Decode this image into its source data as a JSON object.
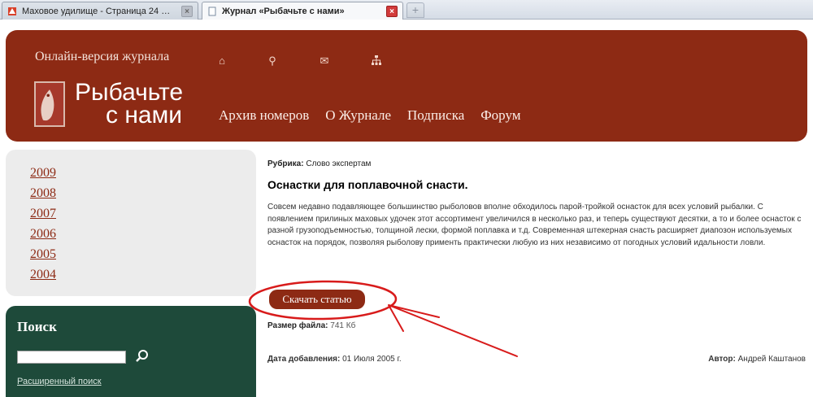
{
  "browser": {
    "tabs": [
      {
        "title": "Маховое удилище - Страница 24 - Ф...",
        "close": "×"
      },
      {
        "title": "Журнал «Рыбачьте с нами»",
        "close": "×"
      }
    ],
    "newtab_symbol": "+"
  },
  "header": {
    "online_label": "Онлайн-версия журнала",
    "icons": [
      "home-icon",
      "search-icon",
      "mail-icon",
      "sitemap-icon"
    ],
    "logo_line1": "Рыбачьте",
    "logo_line2": "с нами",
    "nav": [
      "Архив номеров",
      "О Журнале",
      "Подписка",
      "Форум"
    ]
  },
  "sidebar": {
    "years": [
      "2009",
      "2008",
      "2007",
      "2006",
      "2005",
      "2004"
    ],
    "search": {
      "title": "Поиск",
      "value": "",
      "advanced_link": "Расширенный поиск"
    }
  },
  "article": {
    "rubric_label": "Рубрика:",
    "rubric_value": "Слово экспертам",
    "title": "Оснастки для поплавочной снасти.",
    "body": "Совсем недавно подавляющее большинство рыболовов вполне обходилось парой-тройкой оснасток для всех условий рыбалки. С появлением прилиных маховых удочек этот ассортимент увеличился в несколько раз, и теперь существуют десятки, а то и более оснасток с разной грузоподъемностью, толщиной лески, формой поплавка и т.д. Современная штекерная снасть расширяет диапозон используемых оснасток на порядок, позволяя рыболову применть практически любую из них независимо от погодных условий идальности ловли.",
    "download_label": "Скачать статью",
    "filesize_label": "Размер файла:",
    "filesize_value": "741 Кб",
    "date_label": "Дата добавления:",
    "date_value": "01 Июля 2005 г.",
    "author_label": "Автор:",
    "author_value": "Андрей Каштанов"
  },
  "colors": {
    "brand_red": "#8d2a14",
    "sidebar_green": "#1e4a3a",
    "annotation_red": "#d81b1b"
  }
}
